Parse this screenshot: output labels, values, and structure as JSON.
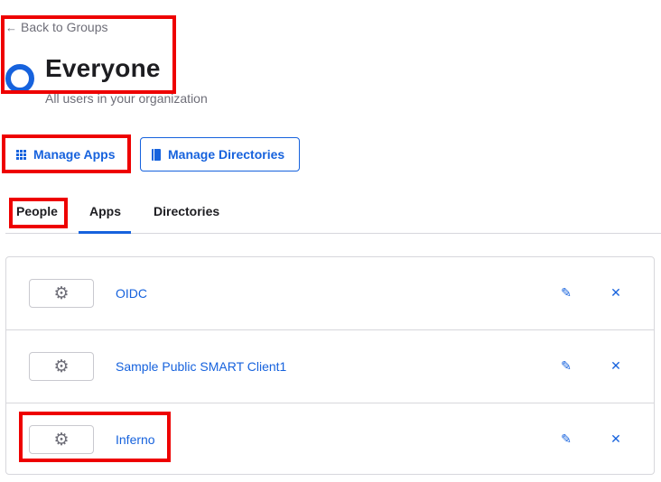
{
  "back_link": {
    "arrow": "←",
    "label": "Back to Groups"
  },
  "group": {
    "title": "Everyone",
    "subtitle": "All users in your organization"
  },
  "actions": {
    "manage_apps": "Manage Apps",
    "manage_directories": "Manage Directories"
  },
  "tabs": [
    {
      "label": "People"
    },
    {
      "label": "Apps",
      "active": true
    },
    {
      "label": "Directories"
    }
  ],
  "apps": [
    {
      "name": "OIDC",
      "icon": "gear-icon"
    },
    {
      "name": "Sample Public SMART Client1",
      "icon": "gear-icon"
    },
    {
      "name": "Inferno",
      "icon": "gear-icon"
    }
  ],
  "icons": {
    "gear": "⚙",
    "edit": "✎",
    "remove": "✕"
  },
  "colors": {
    "accent": "#1662dd",
    "annotation": "#ee0000"
  }
}
